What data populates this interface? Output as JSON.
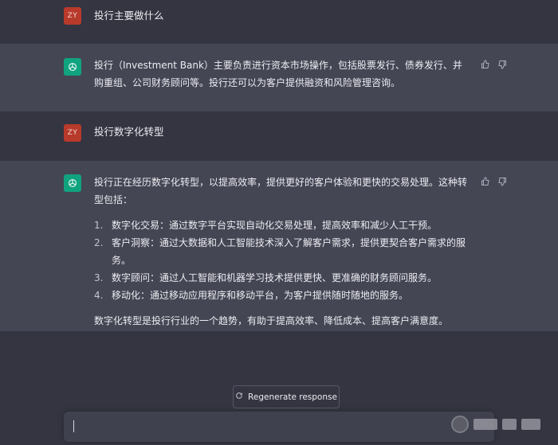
{
  "conversation": [
    {
      "role": "user",
      "avatar_text": "ZY",
      "text": "投行主要做什么"
    },
    {
      "role": "assistant",
      "text": "投行（Investment Bank）主要负责进行资本市场操作，包括股票发行、债券发行、并购重组、公司财务顾问等。投行还可以为客户提供融资和风险管理咨询。"
    },
    {
      "role": "user",
      "avatar_text": "ZY",
      "text": "投行数字化转型"
    },
    {
      "role": "assistant",
      "intro": "投行正在经历数字化转型，以提高效率，提供更好的客户体验和更快的交易处理。这种转型包括：",
      "points": [
        {
          "num": "1.",
          "text": "数字化交易：通过数字平台实现自动化交易处理，提高效率和减少人工干预。"
        },
        {
          "num": "2.",
          "text": "客户洞察：通过大数据和人工智能技术深入了解客户需求，提供更契合客户需求的服务。"
        },
        {
          "num": "3.",
          "text": "数字顾问：通过人工智能和机器学习技术提供更快、更准确的财务顾问服务。"
        },
        {
          "num": "4.",
          "text": "移动化：通过移动应用程序和移动平台，为客户提供随时随地的服务。"
        }
      ],
      "summary": "数字化转型是投行行业的一个趋势，有助于提高效率、降低成本、提高客户满意度。"
    }
  ],
  "regenerate_label": "Regenerate response",
  "composer": {
    "placeholder": ""
  },
  "colors": {
    "background": "#343541",
    "assistant_row": "#444654",
    "user_avatar": "#B83A2B",
    "bot_avatar": "#10A37F"
  },
  "icons": [
    "openai-logo-icon",
    "thumbs-up-icon",
    "thumbs-down-icon",
    "regenerate-icon"
  ]
}
